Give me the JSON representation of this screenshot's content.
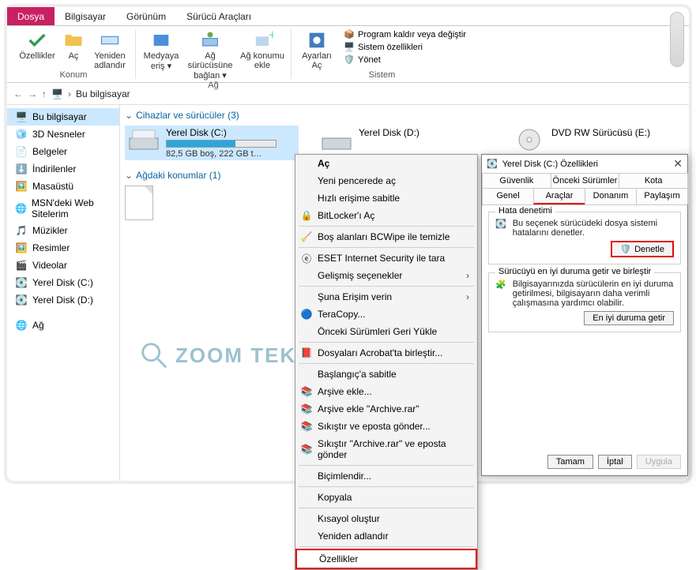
{
  "tabs": {
    "file": "Dosya",
    "computer": "Bilgisayar",
    "view": "Görünüm",
    "drivetools": "Sürücü Araçları"
  },
  "ribbon": {
    "group_location": "Konum",
    "group_network": "Ağ",
    "group_system": "Sistem",
    "properties": "Özellikler",
    "open": "Aç",
    "rename": "Yeniden\nadlandır",
    "media_access": "Medyaya\neriş ▾",
    "map_drive": "Ağ sürücüsüne\nbağlan ▾",
    "add_location": "Ağ konumu\nekle",
    "settings_open": "Ayarları\nAç",
    "sys1": "Program kaldır veya değiştir",
    "sys2": "Sistem özellikleri",
    "sys3": "Yönet"
  },
  "breadcrumb": {
    "root": "Bu bilgisayar"
  },
  "sidebar": {
    "items": [
      {
        "label": "Bu bilgisayar",
        "selected": true
      },
      {
        "label": "3D Nesneler"
      },
      {
        "label": "Belgeler"
      },
      {
        "label": "İndirilenler"
      },
      {
        "label": "Masaüstü"
      },
      {
        "label": "MSN'deki Web Sitelerim"
      },
      {
        "label": "Müzikler"
      },
      {
        "label": "Resimler"
      },
      {
        "label": "Videolar"
      },
      {
        "label": "Yerel Disk (C:)"
      },
      {
        "label": "Yerel Disk (D:)"
      }
    ],
    "network": "Ağ"
  },
  "content": {
    "devices_hdr": "Cihazlar ve sürücüler (3)",
    "network_hdr": "Ağdaki konumlar (1)",
    "drives": {
      "c": {
        "name": "Yerel Disk (C:)",
        "size": "82,5 GB boş, 222 GB t…",
        "fillpct": 63
      },
      "d": {
        "name": "Yerel Disk (D:)"
      },
      "e": {
        "name": "DVD RW Sürücüsü (E:)"
      }
    }
  },
  "ctx": {
    "open": "Aç",
    "open_new": "Yeni pencerede aç",
    "pin_quick": "Hızlı erişime sabitle",
    "bitlocker": "BitLocker'ı Aç",
    "bcwipe": "Boş alanları BCWipe ile temizle",
    "eset": "ESET Internet Security ile tara",
    "advanced": "Gelişmiş seçenekler",
    "give_access": "Şuna Erişim verin",
    "teracopy": "TeraCopy...",
    "prev_versions": "Önceki Sürümleri Geri Yükle",
    "acrobat": "Dosyaları Acrobat'ta birleştir...",
    "pin_start": "Başlangıç'a sabitle",
    "arch_add": "Arşive ekle...",
    "arch_add_named": "Arşive ekle \"Archive.rar\"",
    "arch_zip_send": "Sıkıştır ve eposta gönder...",
    "arch_named_send": "Sıkıştır \"Archive.rar\" ve eposta gönder",
    "format": "Biçimlendir...",
    "copy": "Kopyala",
    "shortcut": "Kısayol oluştur",
    "rename": "Yeniden adlandır",
    "properties": "Özellikler"
  },
  "dlg": {
    "title": "Yerel Disk (C:) Özellikleri",
    "tabs_row1": {
      "a": "Güvenlik",
      "b": "Önceki Sürümler",
      "c": "Kota"
    },
    "tabs_row2": {
      "a": "Genel",
      "b": "Araçlar",
      "c": "Donanım",
      "d": "Paylaşım"
    },
    "grp1_title": "Hata denetimi",
    "grp1_text": "Bu seçenek sürücüdeki dosya sistemi hatalarını denetler.",
    "grp1_btn": "Denetle",
    "grp2_title": "Sürücüyü en iyi duruma getir ve birleştir",
    "grp2_text": "Bilgisayarınızda sürücülerin en iyi duruma getirilmesi, bilgisayarın daha verimli çalışmasına yardımcı olabilir.",
    "grp2_btn": "En iyi duruma getir",
    "ok": "Tamam",
    "cancel": "İptal",
    "apply": "Uygula"
  },
  "watermark": "ZOOM TEKNO"
}
